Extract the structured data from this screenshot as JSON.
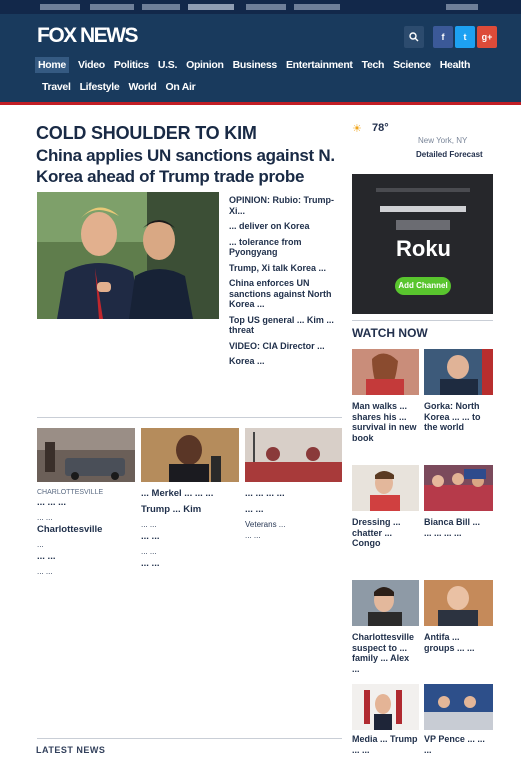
{
  "brand": {
    "logo": "FOX NEWS",
    "colors": {
      "header": "#193a5d",
      "accent": "#c21e25",
      "facebook": "#3b5998",
      "twitter": "#1da1f2",
      "google": "#dd4b39"
    }
  },
  "header": {
    "search_icon": "search-icon",
    "social": [
      "f",
      "t",
      "g+"
    ]
  },
  "nav": {
    "row1": [
      "Home",
      "Video",
      "Politics",
      "U.S.",
      "Opinion",
      "Business",
      "Entertainment",
      "Tech",
      "Science",
      "Health"
    ],
    "row2": [
      "Travel",
      "Lifestyle",
      "World",
      "On Air"
    ],
    "active": "Home"
  },
  "top_story": {
    "kicker": "COLD SHOULDER TO KIM",
    "headline": "China applies UN sanctions against N. Korea ahead of Trump trade probe"
  },
  "side_stories": [
    "OPINION: Rubio: Trump-Xi...",
    "... deliver on  Korea",
    "... tolerance from Pyongyang",
    "Trump, Xi talk Korea ...",
    "China enforces UN sanctions against North Korea ...",
    "Top US general ... Kim ... threat",
    "VIDEO: CIA Director ...",
    "Korea ... "
  ],
  "weather": {
    "temp": "78°",
    "location": "New York, NY",
    "link": "Detailed Forecast"
  },
  "ad": {
    "brand": "Roku",
    "cta": "Add Channel"
  },
  "watch_now": {
    "label": "WATCH NOW",
    "items": [
      {
        "caption": "Man walks ... shares his ... survival in new book"
      },
      {
        "caption": "Gorka: North Korea ... ... to the world"
      },
      {
        "caption": "Dressing ... chatter ... Congo"
      },
      {
        "caption": "Bianca Bill ... ... ... ... ..."
      },
      {
        "caption": "Charlottesville suspect to ... family ... Alex ..."
      },
      {
        "caption": "Antifa ... groups ... ..."
      },
      {
        "caption": "Media ... Trump ... ..."
      },
      {
        "caption": "VP Pence ... ... ..."
      }
    ]
  },
  "tiles": [
    {
      "caption": "... ... ... ..."
    },
    {
      "caption": "... Merkel ... ... ..."
    },
    {
      "caption": "... ... ... ..."
    }
  ],
  "columns": {
    "left": [
      "CHARLOTTESVILLE",
      "... ... ...",
      "... ...",
      "Charlottesville",
      "...",
      "... ...",
      "... ..."
    ],
    "mid": [
      "Trump ... Kim",
      "... ...",
      "... ...",
      "... ...",
      "... ..."
    ],
    "right": [
      "... ...",
      "Veterans ...",
      "... ..."
    ]
  },
  "section_footer": "LATEST NEWS"
}
